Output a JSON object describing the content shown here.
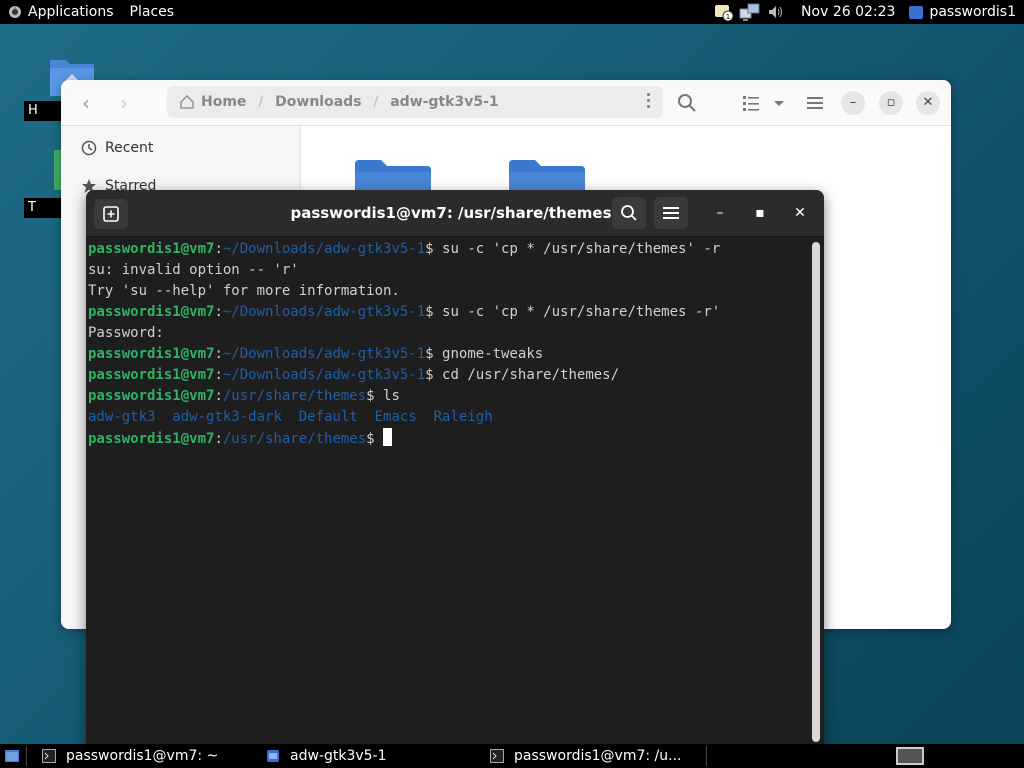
{
  "top_panel": {
    "applications_label": "Applications",
    "places_label": "Places",
    "clock": "Nov 26  02:23",
    "user_label": "passwordis1"
  },
  "desktop": {
    "icon1_label": "H",
    "icon2_label": "T"
  },
  "files": {
    "path": {
      "home": "Home",
      "downloads": "Downloads",
      "current": "adw-gtk3v5-1"
    },
    "sidebar": {
      "recent": "Recent",
      "starred": "Starred"
    }
  },
  "terminal": {
    "title": "passwordis1@vm7: /usr/share/themes",
    "lines": [
      {
        "user": "passwordis1@vm7",
        "sep": ":",
        "path": "~/Downloads/adw-gtk3v5-1",
        "cmd": "$ su -c 'cp * /usr/share/themes' -r"
      },
      {
        "text": "su: invalid option -- 'r'"
      },
      {
        "text": "Try 'su --help' for more information."
      },
      {
        "user": "passwordis1@vm7",
        "sep": ":",
        "path": "~/Downloads/adw-gtk3v5-1",
        "cmd": "$ su -c 'cp * /usr/share/themes -r'"
      },
      {
        "text": "Password:"
      },
      {
        "user": "passwordis1@vm7",
        "sep": ":",
        "path": "~/Downloads/adw-gtk3v5-1",
        "cmd": "$ gnome-tweaks"
      },
      {
        "user": "passwordis1@vm7",
        "sep": ":",
        "path": "~/Downloads/adw-gtk3v5-1",
        "cmd": "$ cd /usr/share/themes/"
      },
      {
        "user": "passwordis1@vm7",
        "sep": ":",
        "path": "/usr/share/themes",
        "cmd": "$ ls"
      },
      {
        "dirs": [
          "adw-gtk3",
          "adw-gtk3-dark",
          "Default",
          "Emacs",
          "Raleigh"
        ]
      },
      {
        "user": "passwordis1@vm7",
        "sep": ":",
        "path": "/usr/share/themes",
        "cmd": "$ ",
        "cursor": true
      }
    ]
  },
  "taskbar": {
    "task1": "passwordis1@vm7: ~",
    "task2": "adw-gtk3v5-1",
    "task3": "passwordis1@vm7: /u..."
  },
  "colors": {
    "prompt_user": "#2fb465",
    "prompt_path": "#1e5fa8",
    "terminal_bg": "#1e1e1e",
    "folder_blue": "#4a86d8"
  }
}
